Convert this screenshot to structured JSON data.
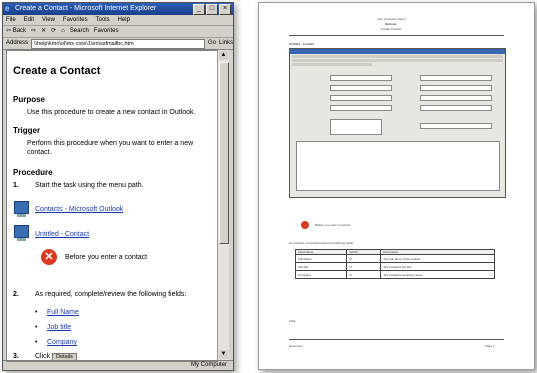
{
  "browser": {
    "title": "Create a Contact - Microsoft Internet Explorer",
    "controls": [
      "_",
      "□",
      "×"
    ],
    "menus": [
      "File",
      "Edit",
      "View",
      "Favorites",
      "Tools",
      "Help"
    ],
    "toolbar": [
      "⇦ Back",
      "⇨",
      "✕",
      "⟳",
      "⌂",
      "Search",
      "Favorites"
    ],
    "address_label": "Address",
    "address_value": "\\\\help\\kmn\\ol\\ms core\\1\\en\\ssfmailbc.htm",
    "go_label": "Go",
    "links_label": "Links",
    "status_zone": "My Computer"
  },
  "page": {
    "title": "Create a Contact",
    "purpose_heading": "Purpose",
    "purpose_text": "Use this procedure to create a new contact in Outlook.",
    "trigger_heading": "Trigger",
    "trigger_text_1": "Perform this procedure when you want to enter a new",
    "trigger_text_2": "contact.",
    "procedure_heading": "Procedure",
    "step1_num": "1.",
    "step1_text": "Start the task using the menu path.",
    "link1": "Contacts - Microsoft Outlook",
    "link2": "Untitled - Contact",
    "stop_text": "Before you enter a contact",
    "step2_num": "2.",
    "step2_text": "As required, complete/review the following fields:",
    "fields": [
      "Full Name",
      "Job title",
      "Company"
    ],
    "step3_num": "3.",
    "step3_text": "Click",
    "step3_button": "Details"
  },
  "document": {
    "header_1": "Your Company Name",
    "header_2": "Outlook",
    "header_3": "Create Contact",
    "section_title": "Untitled - Contact",
    "stop_text": "Before you enter a contact",
    "step_text": "As required, complete/review the following fields:",
    "table_headers": [
      "Field Name",
      "R/O/C",
      "Description"
    ],
    "table_rows": [
      [
        "Full Name",
        "R",
        "The full name of the contact."
      ],
      [
        "Job title",
        "O",
        "The contact's job title."
      ],
      [
        "Company",
        "O",
        "The contact's company name."
      ]
    ],
    "step3_text": "Click",
    "footer_left": "Document",
    "footer_right": "Page 1"
  }
}
